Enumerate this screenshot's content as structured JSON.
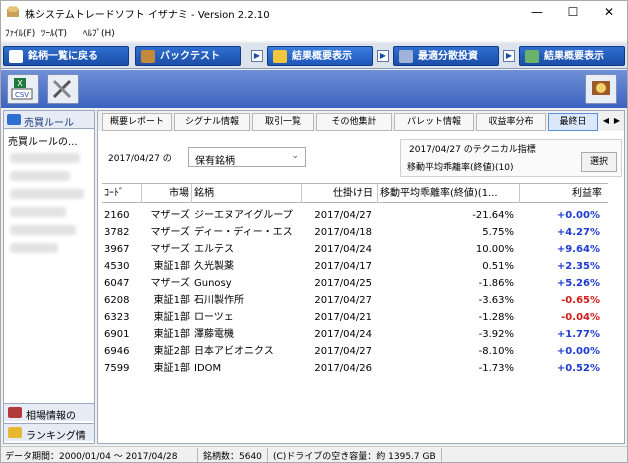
{
  "window": {
    "title": "株システムトレードソフト イザナミ - Version 2.2.10",
    "controls": {
      "minimize": "—",
      "maximize": "☐",
      "close": "✕"
    }
  },
  "menu": [
    "ﾌｧｲﾙ(F)",
    "ﾂｰﾙ(T)",
    "ﾍﾙﾌﾟ(H)"
  ],
  "nav": [
    {
      "label": "銘柄一覧に戻る",
      "icon": "binoculars-icon"
    },
    {
      "label": "バックテスト",
      "icon": "money-bag-icon"
    },
    {
      "label": "結果概要表示",
      "icon": "chart-icon"
    },
    {
      "label": "最適分散投資",
      "icon": "grid-icon"
    },
    {
      "label": "結果概要表示",
      "icon": "bar-chart-icon"
    }
  ],
  "toolbar": {
    "csv_label": "CSV",
    "tools_icon": "tools-icon",
    "help_icon": "help-icon"
  },
  "left_panel": {
    "header": "売買ルール",
    "selected_item": "売買ルールの...",
    "bottom_buttons": [
      "相場情報の",
      "ランキング情"
    ]
  },
  "tabs": [
    "概要レポート",
    "シグナル情報",
    "取引一覧",
    "その他集計",
    "パレット情報",
    "収益率分布",
    "最終日"
  ],
  "filter": {
    "date_label": "2017/04/27 の",
    "select_value": "保有銘柄",
    "indicator_line1": "2017/04/27 のテクニカル指標",
    "indicator_line2": "移動平均乖離率(終値)(10)",
    "select_button": "選択"
  },
  "table": {
    "headers": [
      "ｺｰﾄﾞ",
      "市場",
      "銘柄",
      "仕掛け日",
      "移動平均乖離率(終値)(1...",
      "利益率"
    ],
    "rows": [
      [
        "2160",
        "マザーズ",
        "ジーエヌアイグループ",
        "2017/04/27",
        "-21.64%",
        "+0.00%"
      ],
      [
        "3782",
        "マザーズ",
        "ディー・ディー・エス",
        "2017/04/18",
        "5.75%",
        "+4.27%"
      ],
      [
        "3967",
        "マザーズ",
        "エルテス",
        "2017/04/24",
        "10.00%",
        "+9.64%"
      ],
      [
        "4530",
        "東証1部",
        "久光製薬",
        "2017/04/17",
        "0.51%",
        "+2.35%"
      ],
      [
        "6047",
        "マザーズ",
        "Gunosy",
        "2017/04/25",
        "-1.86%",
        "+5.26%"
      ],
      [
        "6208",
        "東証1部",
        "石川製作所",
        "2017/04/27",
        "-3.63%",
        "-0.65%"
      ],
      [
        "6323",
        "東証1部",
        "ローツェ",
        "2017/04/21",
        "-1.28%",
        "-0.04%"
      ],
      [
        "6901",
        "東証1部",
        "澤藤電機",
        "2017/04/24",
        "-3.92%",
        "+1.77%"
      ],
      [
        "6946",
        "東証2部",
        "日本アビオニクス",
        "2017/04/27",
        "-8.10%",
        "+0.00%"
      ],
      [
        "7599",
        "東証1部",
        "IDOM",
        "2017/04/26",
        "-1.73%",
        "+0.52%"
      ]
    ]
  },
  "status": {
    "period": "データ期間：2000/01/04 ～ 2017/04/28",
    "count": "銘柄数：5640",
    "disk": "(C)ドライブの空き容量：約 1395.7 GB"
  },
  "colors": {
    "positive": "#1d3bd1",
    "negative": "#d21a1a",
    "nav": "#1b4ea8"
  }
}
